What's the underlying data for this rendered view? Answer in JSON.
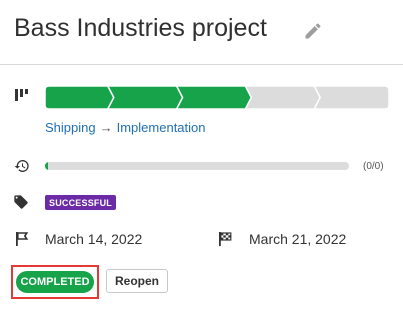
{
  "project": {
    "title": "Bass Industries project"
  },
  "pipeline": {
    "stages_total": 5,
    "stages_completed": 3,
    "colors": {
      "done": "#16a34a",
      "pending": "#dcdcdc"
    },
    "path_from": "Shipping",
    "path_arrow": "→",
    "path_to": "Implementation"
  },
  "progress": {
    "count_label": "(0/0)",
    "fraction": 0.01
  },
  "tags": {
    "status": "SUCCESSFUL",
    "status_color": "#6c2aa6"
  },
  "dates": {
    "start": "March 14, 2022",
    "end": "March 21, 2022"
  },
  "actions": {
    "completed_label": "COMPLETED",
    "reopen_label": "Reopen"
  },
  "icons": {
    "edit": "pencil-icon",
    "pipeline": "pipeline-icon",
    "progress": "timer-icon",
    "tag": "tag-icon",
    "start": "start-flag-icon",
    "end": "finish-flag-icon"
  }
}
